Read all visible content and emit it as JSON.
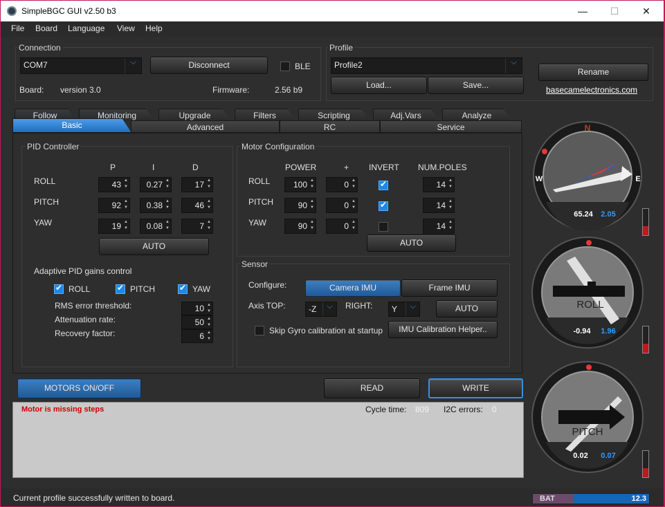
{
  "window": {
    "title": "SimpleBGC GUI v2.50 b3",
    "minimize": "—",
    "maximize": "☐",
    "close": "✕"
  },
  "menu": [
    "File",
    "Board",
    "Language",
    "View",
    "Help"
  ],
  "connection": {
    "label": "Connection",
    "port": "COM7",
    "disconnect": "Disconnect",
    "ble": "BLE",
    "board_label": "Board:",
    "board_value": "version 3.0",
    "firmware_label": "Firmware:",
    "firmware_value": "2.56 b9"
  },
  "profile": {
    "label": "Profile",
    "selected": "Profile2",
    "load": "Load...",
    "save": "Save...",
    "rename": "Rename",
    "link": "basecamelectronics.com"
  },
  "tabs_back": [
    "Follow",
    "Monitoring",
    "Upgrade",
    "Filters",
    "Scripting",
    "Adj.Vars",
    "Analyze"
  ],
  "tabs_front": [
    "Basic",
    "Advanced",
    "RC",
    "Service"
  ],
  "pid": {
    "title": "PID Controller",
    "headers": [
      "P",
      "I",
      "D"
    ],
    "rows": [
      {
        "axis": "ROLL",
        "p": "43",
        "i": "0.27",
        "d": "17"
      },
      {
        "axis": "PITCH",
        "p": "92",
        "i": "0.38",
        "d": "46"
      },
      {
        "axis": "YAW",
        "p": "19",
        "i": "0.08",
        "d": "7"
      }
    ],
    "auto": "AUTO"
  },
  "adaptive": {
    "title": "Adaptive PID gains control",
    "roll": "ROLL",
    "pitch": "PITCH",
    "yaw": "YAW",
    "rms_label": "RMS error threshold:",
    "rms": "10",
    "att_label": "Attenuation rate:",
    "att": "50",
    "rec_label": "Recovery factor:",
    "rec": "6"
  },
  "motor": {
    "title": "Motor Configuration",
    "headers": [
      "POWER",
      "+",
      "INVERT",
      "NUM.POLES"
    ],
    "rows": [
      {
        "axis": "ROLL",
        "power": "100",
        "plus": "0",
        "invert": true,
        "poles": "14"
      },
      {
        "axis": "PITCH",
        "power": "90",
        "plus": "0",
        "invert": true,
        "poles": "14"
      },
      {
        "axis": "YAW",
        "power": "90",
        "plus": "0",
        "invert": false,
        "poles": "14"
      }
    ],
    "auto": "AUTO"
  },
  "sensor": {
    "title": "Sensor",
    "configure": "Configure:",
    "camera_imu": "Camera IMU",
    "frame_imu": "Frame IMU",
    "axis_top_label": "Axis TOP:",
    "axis_top": "-Z",
    "right_label": "RIGHT:",
    "right": "Y",
    "auto": "AUTO",
    "skip_gyro": "Skip Gyro calibration at startup",
    "imu_helper": "IMU Calibration Helper.."
  },
  "actions": {
    "motors": "MOTORS ON/OFF",
    "read": "READ",
    "write": "WRITE"
  },
  "log": {
    "message": "Motor is missing steps",
    "cycle_label": "Cycle time:",
    "cycle": "809",
    "i2c_label": "I2C errors:",
    "i2c": "0"
  },
  "status": {
    "message": "Current profile successfully written to board.",
    "bat_label": "BAT",
    "bat_value": "12.3",
    "bat_fill": 0.77
  },
  "gauges": {
    "yaw": {
      "n": "N",
      "w": "W",
      "e": "E",
      "value": "65.24",
      "value2": "2.05",
      "level": 0.35
    },
    "roll": {
      "name": "ROLL",
      "value": "-0.94",
      "value2": "1.96",
      "level": 0.35
    },
    "pitch": {
      "name": "PITCH",
      "value": "0.02",
      "value2": "0.07",
      "level": 0.35
    }
  },
  "colors": {
    "accent": "#1e88e5",
    "error": "#cc0000",
    "gauge_blue": "#2f9bff"
  }
}
